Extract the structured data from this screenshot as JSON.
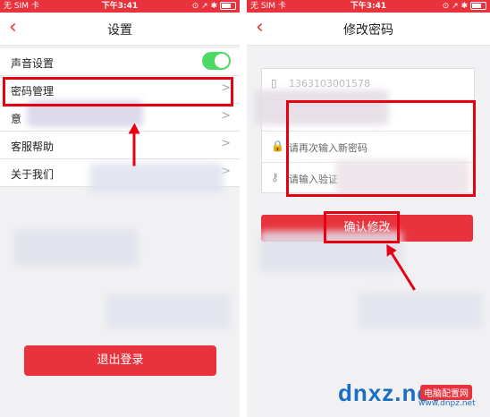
{
  "left_screen": {
    "status": {
      "carrier": "无 SIM 卡 ",
      "time": "下午3:41",
      "right": "⊙ ↗ ✱"
    },
    "nav": {
      "back": "‹",
      "title": "设置"
    },
    "items": [
      {
        "label": "声音设置",
        "toggle": true
      },
      {
        "label": "密码管理"
      },
      {
        "label": "意"
      },
      {
        "label": "客服帮助"
      },
      {
        "label": "关于我们"
      }
    ],
    "logout_label": "退出登录"
  },
  "right_screen": {
    "status": {
      "carrier": "无 SIM 卡 ",
      "time": "下午3:41",
      "right": "⊙ ↗ ✱"
    },
    "nav": {
      "back": "‹",
      "title": "修改密码"
    },
    "fields": [
      {
        "icon": "▯",
        "text": "1363103001578"
      },
      {
        "icon": "",
        "text": ""
      },
      {
        "icon": "🔒",
        "text": "请再次输入新密码"
      },
      {
        "icon": "⚷",
        "text": "请输入验证"
      }
    ],
    "confirm_label": "确认修改"
  },
  "watermark": {
    "logo": "dnxz.net",
    "badge": "电脑配置网",
    "sub": "www.dnpz.net"
  },
  "colors": {
    "accent": "#e8333d",
    "highlight": "#e60012",
    "toggle_on": "#4cd964"
  }
}
